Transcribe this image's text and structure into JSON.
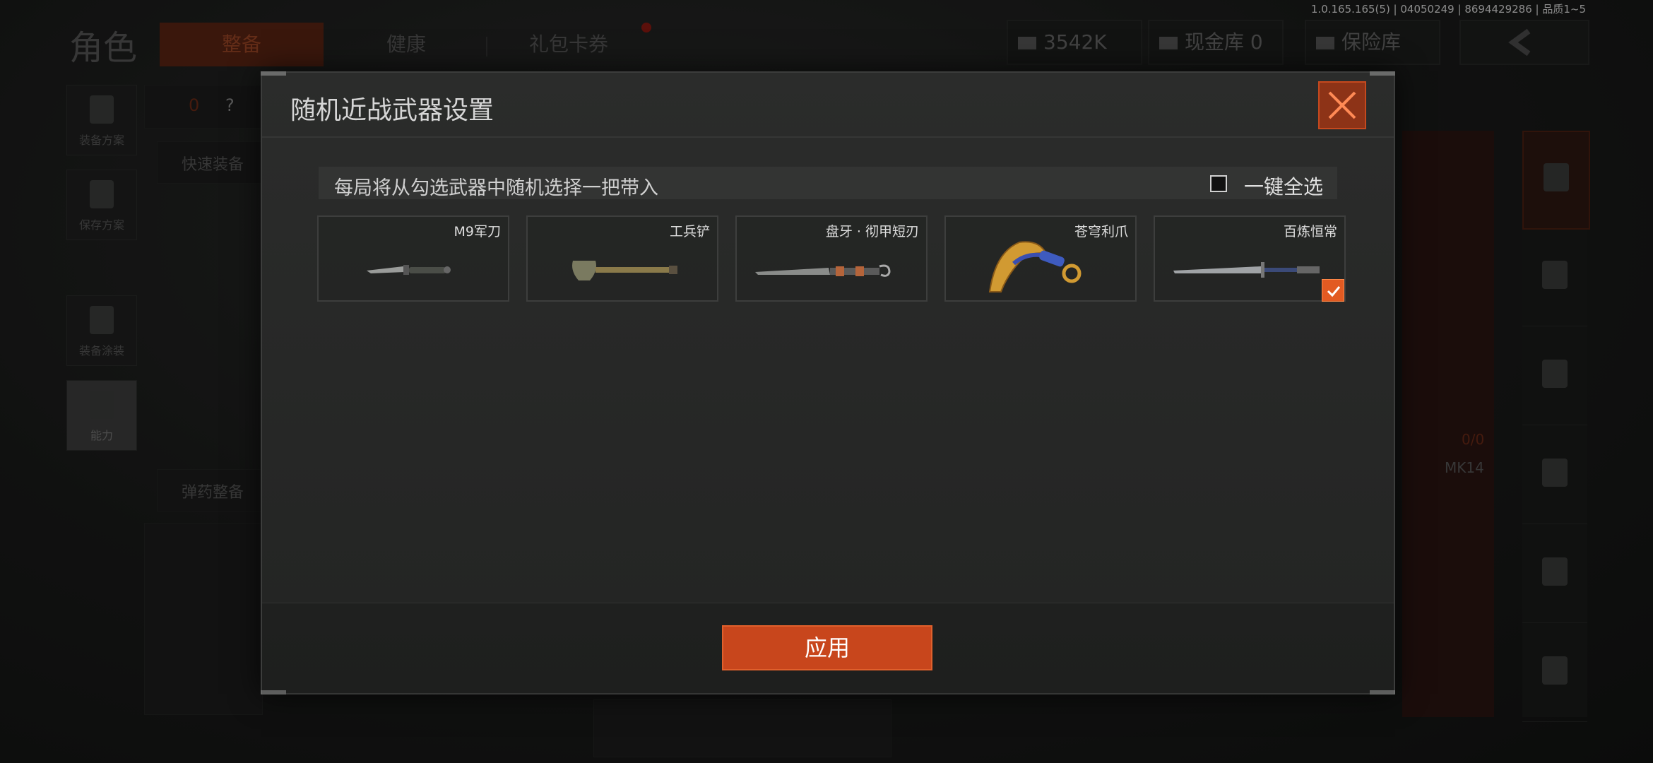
{
  "version_info": "1.0.165.165(5) | 04050249 | 8694429286 | 品质1~5",
  "background": {
    "page_title": "角色",
    "tabs": [
      {
        "label": "整备"
      },
      {
        "label": "健康"
      },
      {
        "label": "礼包卡券"
      }
    ],
    "currency": {
      "money": "3542K",
      "cash_vault": "现金库 0",
      "safe_box": "保险库"
    },
    "left_nav": [
      {
        "label": "装备方案"
      },
      {
        "label": "保存方案"
      },
      {
        "label": "装备涂装"
      },
      {
        "label": "能力"
      }
    ],
    "quick_equip": "快速装备",
    "ammo_arrange": "弹药整备",
    "loadout_count": "0",
    "help_mark": "?",
    "right_weapon_label": "MK14",
    "right_ammo_count": "0/0"
  },
  "modal": {
    "title": "随机近战武器设置",
    "hint": "每局将从勾选武器中随机选择一把带入",
    "select_all_label": "一键全选",
    "select_all_checked": false,
    "weapons": [
      {
        "name": "M9军刀",
        "checked": false
      },
      {
        "name": "工兵铲",
        "checked": false
      },
      {
        "name": "盘牙 · 彻甲短刃",
        "checked": false
      },
      {
        "name": "苍穹利爪",
        "checked": false
      },
      {
        "name": "百炼恒常",
        "checked": true
      }
    ],
    "apply_label": "应用"
  },
  "colors": {
    "accent": "#c8461c",
    "check": "#e25a22",
    "close_bg": "#8d3317"
  }
}
